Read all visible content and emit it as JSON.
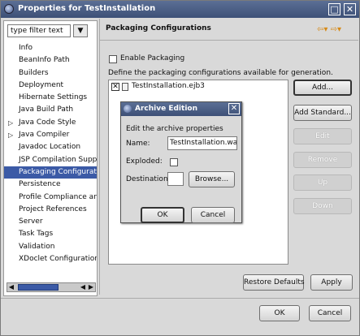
{
  "window": {
    "title": "Properties for TestInstallation",
    "buttons": [
      "□",
      "✕"
    ]
  },
  "filter": {
    "value": "type filter text",
    "button_icon": "▼"
  },
  "tree_items": [
    {
      "label": "Info",
      "expandable": false
    },
    {
      "label": "BeanInfo Path",
      "expandable": false
    },
    {
      "label": "Builders",
      "expandable": false
    },
    {
      "label": "Deployment",
      "expandable": false
    },
    {
      "label": "Hibernate Settings",
      "expandable": false
    },
    {
      "label": "Java Build Path",
      "expandable": false
    },
    {
      "label": "Java Code Style",
      "expandable": true
    },
    {
      "label": "Java Compiler",
      "expandable": true
    },
    {
      "label": "Javadoc Location",
      "expandable": false
    },
    {
      "label": "JSP Compilation Suppor",
      "expandable": false
    },
    {
      "label": "Packaging Configuratio",
      "expandable": false,
      "selected": true
    },
    {
      "label": "Persistence",
      "expandable": false
    },
    {
      "label": "Profile Compliance and",
      "expandable": false
    },
    {
      "label": "Project References",
      "expandable": false
    },
    {
      "label": "Server",
      "expandable": false
    },
    {
      "label": "Task Tags",
      "expandable": false
    },
    {
      "label": "Validation",
      "expandable": false
    },
    {
      "label": "XDoclet Configurations",
      "expandable": false
    }
  ],
  "page": {
    "heading": "Packaging Configurations",
    "nav_icons": "⇦▾ ⇨▾",
    "enable_label": "Enable Packaging",
    "description": "Define the packaging configurations available for generation.",
    "list_item": "TestInstallation.ejb3"
  },
  "side_buttons": {
    "add": "Add...",
    "add_standard": "Add Standard...",
    "edit": "Edit",
    "remove": "Remove",
    "up": "Up",
    "down": "Down"
  },
  "footer": {
    "restore_defaults": "Restore Defaults",
    "apply": "Apply",
    "ok": "OK",
    "cancel": "Cancel"
  },
  "dialog": {
    "title": "Archive Edition",
    "prompt": "Edit the archive properties",
    "name_label": "Name:",
    "name_value": "TestInstallation.war",
    "exploded_label": "Exploded:",
    "destination_label": "Destination:",
    "destination_value": "",
    "browse": "Browse...",
    "ok": "OK",
    "cancel": "Cancel"
  }
}
